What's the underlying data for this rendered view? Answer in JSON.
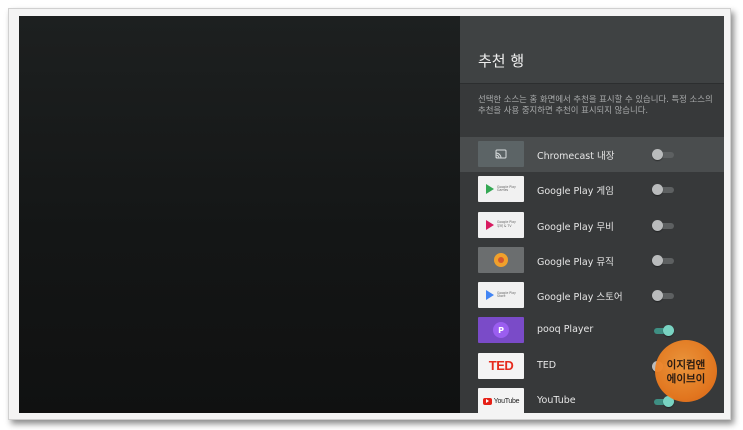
{
  "panel": {
    "title": "추천 행",
    "description": "선택한 소스는 홈 화면에서 추천을 표시할 수 있습니다. 특정 소스의 추천을 사용 중지하면 추천이 표시되지 않습니다."
  },
  "rows": [
    {
      "label": "Chromecast 내장",
      "enabled": false,
      "icon": "cast-icon",
      "selected": true
    },
    {
      "label": "Google Play 게임",
      "enabled": false,
      "icon": "google-play-games-icon",
      "thumb_text": [
        "Google Play",
        "Games"
      ],
      "accent": "#34a853"
    },
    {
      "label": "Google Play 무비",
      "enabled": false,
      "icon": "google-play-movies-icon",
      "thumb_text": [
        "Google Play",
        "무비 & TV"
      ],
      "accent": "#d81b60"
    },
    {
      "label": "Google Play 뮤직",
      "enabled": false,
      "icon": "google-play-music-icon"
    },
    {
      "label": "Google Play 스토어",
      "enabled": false,
      "icon": "google-play-store-icon",
      "thumb_text": [
        "Google Play",
        "Store"
      ],
      "accent": "#4285f4"
    },
    {
      "label": "pooq Player",
      "enabled": true,
      "icon": "pooq-icon",
      "thumb_text": [
        "P"
      ]
    },
    {
      "label": "TED",
      "enabled": false,
      "icon": "ted-logo-icon",
      "thumb_text": [
        "TED"
      ]
    },
    {
      "label": "YouTube",
      "enabled": true,
      "icon": "youtube-logo-icon",
      "thumb_text": [
        "YouTube"
      ]
    }
  ],
  "watermark": {
    "line1": "이지컴앤",
    "line2": "에이브이"
  },
  "colors": {
    "toggle_on": "#79d3c2",
    "toggle_off": "#b9bbbc",
    "panel_bg": "#37393a"
  }
}
